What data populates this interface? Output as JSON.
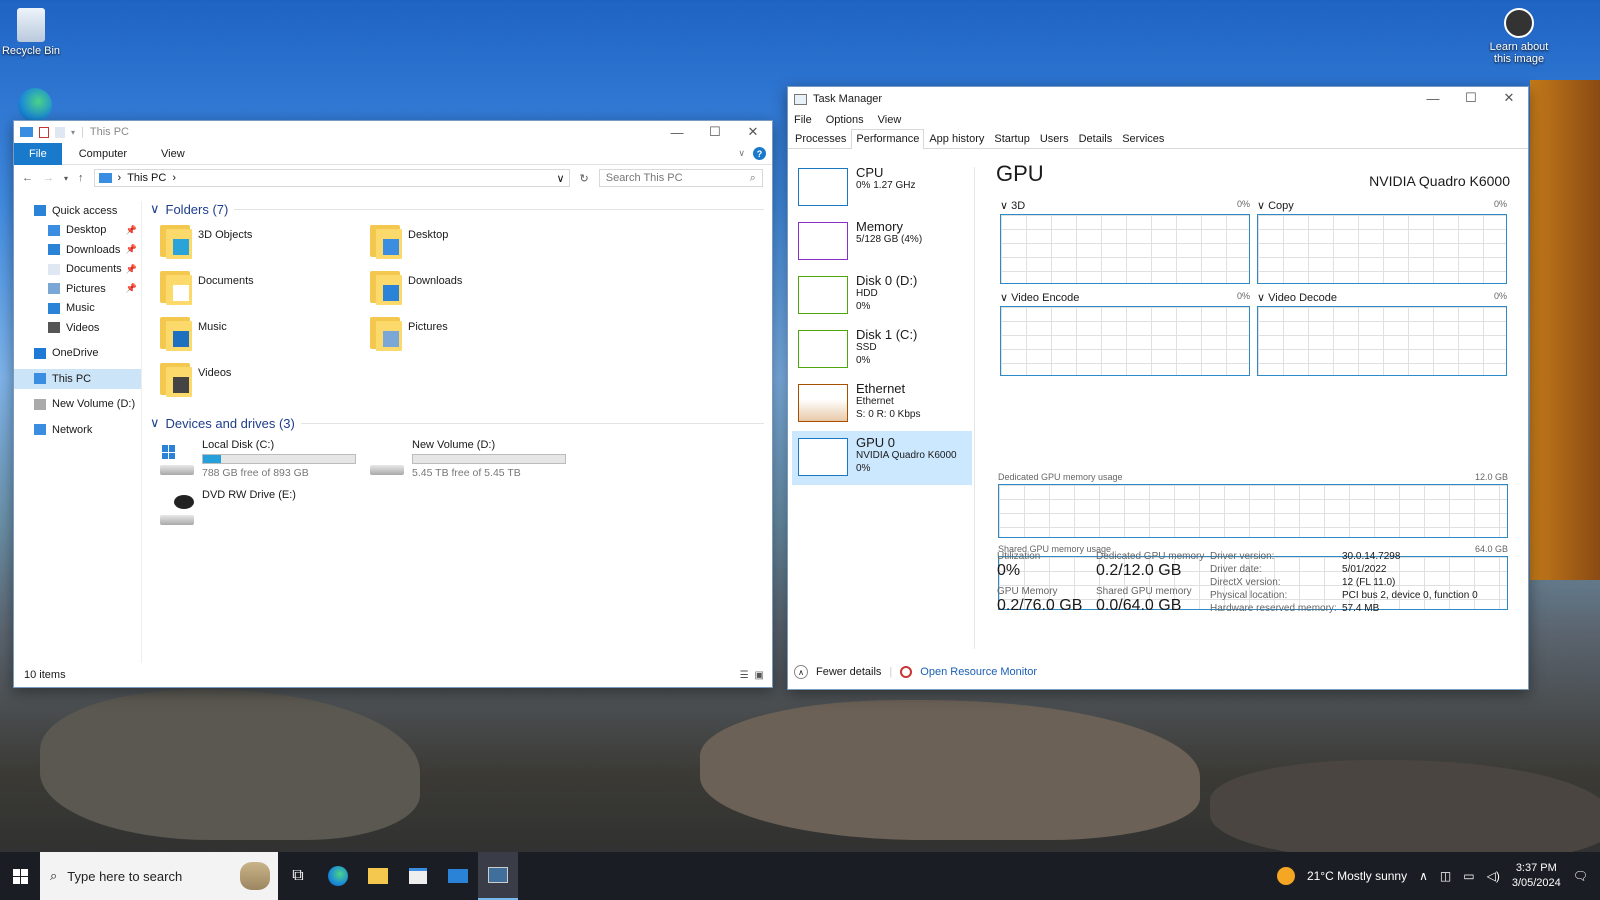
{
  "desktop": {
    "recycle_bin": "Recycle Bin",
    "learn_about": "Learn about this image"
  },
  "explorer": {
    "title": "This PC",
    "ribbon_tabs": [
      "File",
      "Computer",
      "View"
    ],
    "address": "This PC",
    "search_placeholder": "Search This PC",
    "sidebar": [
      {
        "label": "Quick access",
        "icon": "star-icon",
        "level": "top"
      },
      {
        "label": "Desktop",
        "icon": "desktop-icon",
        "pinned": true
      },
      {
        "label": "Downloads",
        "icon": "download-arrow-icon",
        "pinned": true
      },
      {
        "label": "Documents",
        "icon": "document-icon",
        "pinned": true
      },
      {
        "label": "Pictures",
        "icon": "picture-icon",
        "pinned": true
      },
      {
        "label": "Music",
        "icon": "music-icon"
      },
      {
        "label": "Videos",
        "icon": "video-icon"
      },
      {
        "label": "OneDrive",
        "icon": "cloud-icon",
        "level": "top"
      },
      {
        "label": "This PC",
        "icon": "computer-icon",
        "level": "top",
        "selected": true
      },
      {
        "label": "New Volume (D:)",
        "icon": "drive-icon",
        "level": "top"
      },
      {
        "label": "Network",
        "icon": "network-icon",
        "level": "top"
      }
    ],
    "folders_header": "Folders (7)",
    "folders": [
      "3D Objects",
      "Desktop",
      "Documents",
      "Downloads",
      "Music",
      "Pictures",
      "Videos"
    ],
    "drives_header": "Devices and drives (3)",
    "drives": [
      {
        "name": "Local Disk (C:)",
        "free": "788 GB free of 893 GB",
        "used_fraction": 0.12
      },
      {
        "name": "New Volume (D:)",
        "free": "5.45 TB free of 5.45 TB",
        "used_fraction": 0.0
      },
      {
        "name": "DVD RW Drive (E:)",
        "free": ""
      }
    ],
    "status": "10 items"
  },
  "taskmgr": {
    "title": "Task Manager",
    "menu": [
      "File",
      "Options",
      "View"
    ],
    "tabs": [
      "Processes",
      "Performance",
      "App history",
      "Startup",
      "Users",
      "Details",
      "Services"
    ],
    "active_tab": "Performance",
    "resources": [
      {
        "name": "CPU",
        "sub1": "0% 1.27 GHz",
        "sub2": "",
        "sub3": "",
        "color": "#1a78c2"
      },
      {
        "name": "Memory",
        "sub1": "5/128 GB (4%)",
        "sub2": "",
        "sub3": "",
        "color": "#8b2fc9"
      },
      {
        "name": "Disk 0 (D:)",
        "sub1": "HDD",
        "sub2": "0%",
        "sub3": "",
        "color": "#4da60c"
      },
      {
        "name": "Disk 1 (C:)",
        "sub1": "SSD",
        "sub2": "0%",
        "sub3": "",
        "color": "#4da60c"
      },
      {
        "name": "Ethernet",
        "sub1": "Ethernet",
        "sub2": "S: 0 R: 0 Kbps",
        "sub3": "",
        "color": "#a74f01"
      },
      {
        "name": "GPU 0",
        "sub1": "NVIDIA Quadro K6000",
        "sub2": "0%",
        "sub3": "",
        "color": "#1a78c2",
        "selected": true
      }
    ],
    "gpu": {
      "heading": "GPU",
      "model": "NVIDIA Quadro K6000",
      "engines": [
        {
          "label": "3D",
          "pct": "0%"
        },
        {
          "label": "Copy",
          "pct": "0%"
        },
        {
          "label": "Video Encode",
          "pct": "0%"
        },
        {
          "label": "Video Decode",
          "pct": "0%"
        }
      ],
      "dedicated_label": "Dedicated GPU memory usage",
      "dedicated_max": "12.0 GB",
      "shared_label": "Shared GPU memory usage",
      "shared_max": "64.0 GB",
      "utilization_label": "Utilization",
      "utilization": "0%",
      "dedicated_mem_label": "Dedicated GPU memory",
      "dedicated_mem": "0.2/12.0 GB",
      "gpu_mem_label": "GPU Memory",
      "gpu_mem": "0.2/76.0 GB",
      "shared_mem_label": "Shared GPU memory",
      "shared_mem": "0.0/64.0 GB",
      "details": [
        {
          "k": "Driver version:",
          "v": "30.0.14.7298"
        },
        {
          "k": "Driver date:",
          "v": "5/01/2022"
        },
        {
          "k": "DirectX version:",
          "v": "12 (FL 11.0)"
        },
        {
          "k": "Physical location:",
          "v": "PCI bus 2, device 0, function 0"
        },
        {
          "k": "Hardware reserved memory:",
          "v": "57.4 MB"
        }
      ]
    },
    "fewer_details": "Fewer details",
    "open_resmon": "Open Resource Monitor"
  },
  "taskbar": {
    "search_placeholder": "Type here to search",
    "weather": "21°C  Mostly sunny",
    "time": "3:37 PM",
    "date": "3/05/2024"
  }
}
